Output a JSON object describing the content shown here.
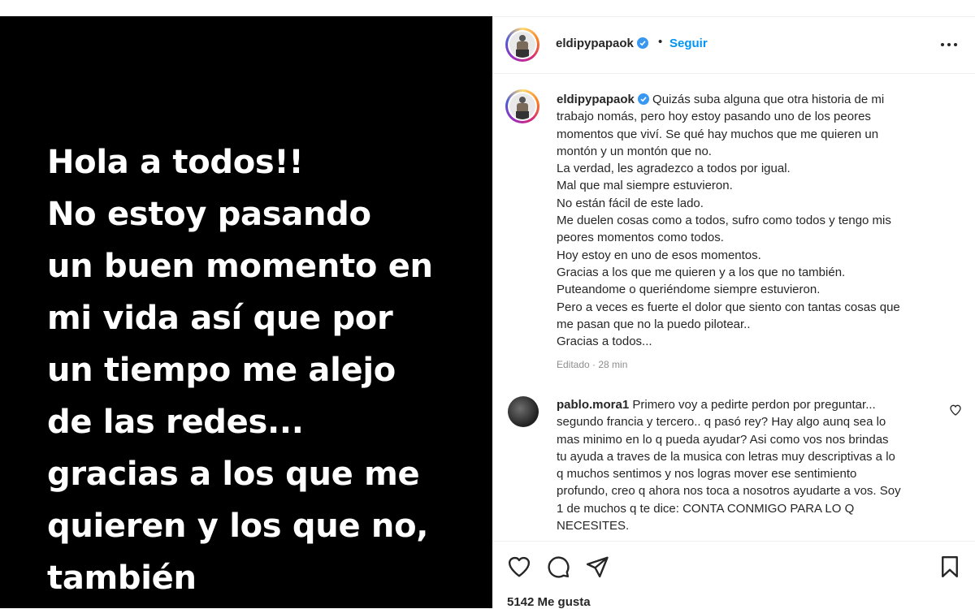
{
  "post_image": {
    "lines": [
      "Hola a todos!!",
      "No estoy pasando",
      "un buen momento en",
      "mi vida así que por",
      "un tiempo me alejo",
      "de las redes...",
      "gracias a los que me",
      "quieren y los que no,",
      "también"
    ]
  },
  "header": {
    "username": "eldipypapaok",
    "separator": "•",
    "follow_label": "Seguir",
    "more_icon": "more-horizontal-icon",
    "verified_icon": "verified-badge-icon"
  },
  "caption": {
    "username": "eldipypapaok",
    "lines": [
      "Quizás suba alguna que otra historia de mi",
      "trabajo nomás, pero hoy estoy pasando uno de los peores",
      "momentos que viví. Se qué hay muchos que me quieren un",
      "montón y un montón que no.",
      "La verdad, les agradezco a todos por igual.",
      "Mal que mal siempre estuvieron.",
      "No están fácil de este lado.",
      "Me duelen cosas como a todos, sufro como todos y tengo mis",
      "peores momentos como todos.",
      "Hoy estoy en uno de esos momentos.",
      "Gracias a los que me quieren y a los que no también.",
      "Puteandome o queriéndome siempre estuvieron.",
      "Pero a veces es fuerte el dolor que siento con tantas cosas que",
      "me pasan que no la puedo pilotear..",
      "Gracias a todos..."
    ],
    "meta": "Editado · 28 min"
  },
  "comment": {
    "username": "pablo.mora1",
    "lines": [
      "Primero voy a pedirte perdon por preguntar...",
      "segundo francia y tercero.. q pasó rey? Hay algo aunq sea lo",
      "mas minimo en lo q pueda ayudar? Asi como vos nos brindas",
      "tu ayuda a traves de la musica con letras muy descriptivas a lo",
      "q muchos sentimos y nos logras mover ese sentimiento",
      "profundo, creo q ahora nos toca a nosotros ayudarte a vos. Soy",
      "1 de muchos q te dice: CONTA CONMIGO PARA LO Q",
      "NECESITES."
    ],
    "like_icon": "heart-outline-icon"
  },
  "actions": {
    "like_icon": "heart-icon",
    "comment_icon": "comment-icon",
    "share_icon": "send-icon",
    "save_icon": "bookmark-icon",
    "likes_text": "5142 Me gusta"
  },
  "colors": {
    "accent": "#0095f6",
    "verified": "#3897f0",
    "text": "#262626",
    "muted": "#8e8e8e",
    "image_background": "#000000"
  }
}
